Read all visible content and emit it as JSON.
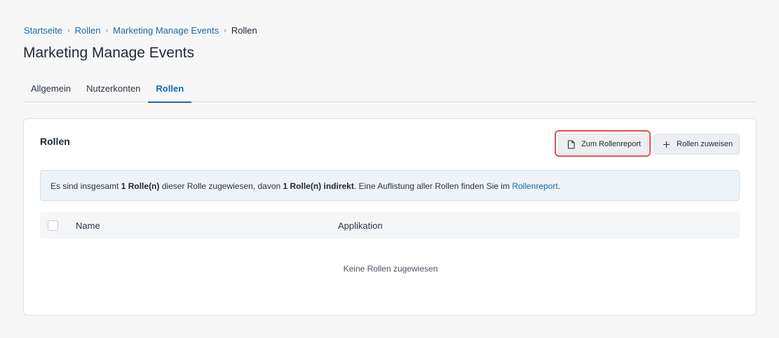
{
  "breadcrumb": {
    "items": [
      "Startseite",
      "Rollen",
      "Marketing Manage Events"
    ],
    "current": "Rollen"
  },
  "page": {
    "title": "Marketing Manage Events"
  },
  "tabs": [
    {
      "label": "Allgemein",
      "active": false
    },
    {
      "label": "Nutzerkonten",
      "active": false
    },
    {
      "label": "Rollen",
      "active": true
    }
  ],
  "card": {
    "title": "Rollen",
    "buttons": {
      "report_label": "Zum Rollenreport",
      "report_icon": "document-icon",
      "assign_label": "Rollen zuweisen",
      "assign_icon": "plus-icon"
    },
    "info": {
      "text_1": "Es sind insgesamt ",
      "bold_1": "1 Rolle(n)",
      "text_2": " dieser Rolle zugewiesen, davon ",
      "bold_2": "1 Rolle(n) indirekt",
      "text_3": ". Eine Auflistung aller Rollen finden Sie im ",
      "link": "Rollenreport",
      "text_4": "."
    },
    "table": {
      "columns": [
        "Name",
        "Applikation"
      ],
      "empty_text": "Keine Rollen zugewiesen"
    }
  },
  "colors": {
    "accent": "#1a6aa7",
    "highlight": "#e2534f",
    "background": "#f7f7f8"
  }
}
